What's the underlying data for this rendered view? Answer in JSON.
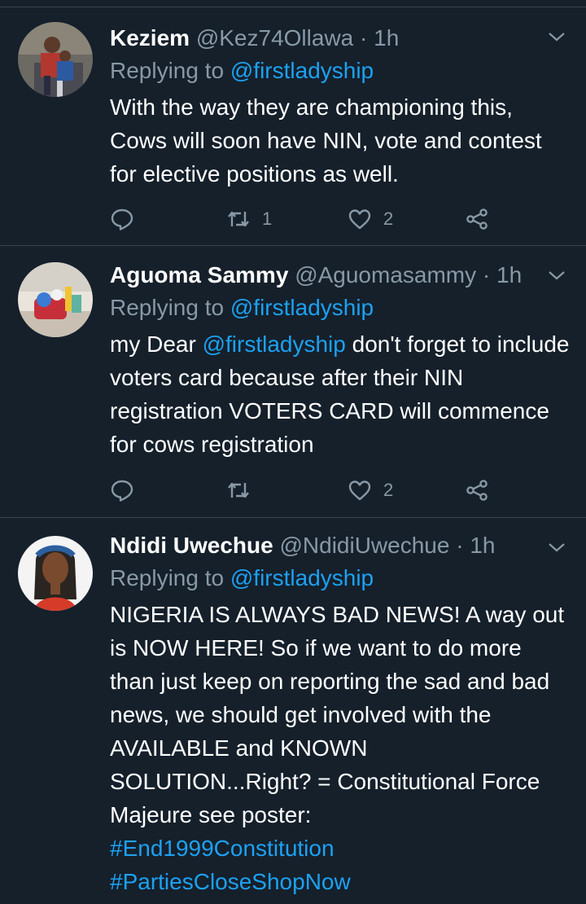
{
  "tweets": [
    {
      "name": "Keziem",
      "handle": "@Kez74Ollawa",
      "sep": "·",
      "time": "1h",
      "replying_prefix": "Replying to",
      "replying_to": "@firstladyship",
      "text": "With the way they are championing this, Cows will soon have NIN, vote and contest for elective positions as well.",
      "retweets": "1",
      "likes": "2"
    },
    {
      "name": "Aguoma Sammy",
      "handle": "@Aguomasammy",
      "sep": "·",
      "time": "1h",
      "replying_prefix": "Replying to",
      "replying_to": "@firstladyship",
      "text_before": "my Dear ",
      "text_mention": "@firstladyship",
      "text_after": " don't forget to include voters card because after their NIN registration VOTERS CARD will commence for cows registration",
      "retweets": "",
      "likes": "2"
    },
    {
      "name": "Ndidi Uwechue",
      "handle": "@NdidiUwechue",
      "sep": "·",
      "time": "1h",
      "replying_prefix": "Replying to",
      "replying_to": "@firstladyship",
      "text": "NIGERIA IS ALWAYS BAD NEWS! A way out is NOW HERE! So if we want to do more than just keep on reporting the sad and bad news, we should get involved with the AVAILABLE and KNOWN SOLUTION...Right? = Constitutional Force Majeure see poster:",
      "hashtags": [
        "#End1999Constitution",
        "#PartiesCloseShopNow"
      ]
    }
  ],
  "colors": {
    "background": "#15202b",
    "secondary_text": "#8899a6",
    "link": "#1da1f2",
    "divider": "#38444d"
  }
}
